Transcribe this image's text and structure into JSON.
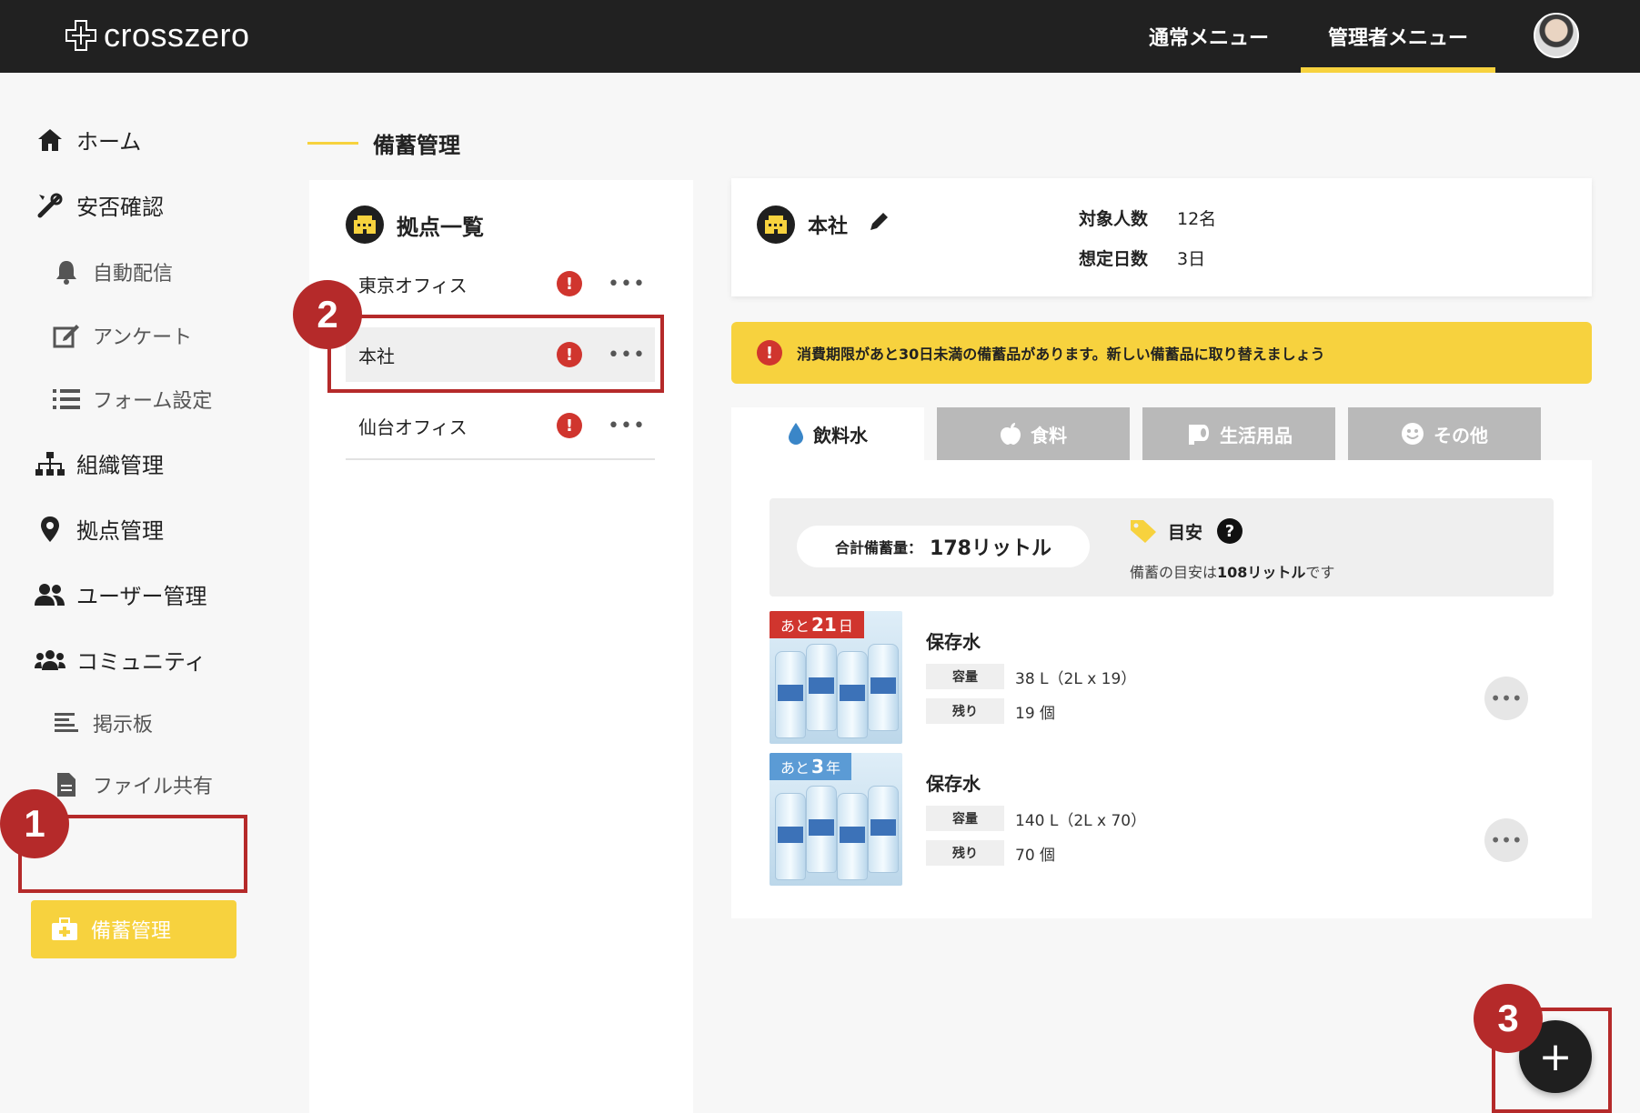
{
  "app": {
    "logo_text": "crosszero"
  },
  "top_nav": [
    {
      "label": "通常メニュー",
      "active": false
    },
    {
      "label": "管理者メニュー",
      "active": true
    }
  ],
  "sidebar": {
    "items": [
      {
        "label": "ホーム",
        "icon": "home-icon"
      },
      {
        "label": "安否確認",
        "icon": "tools-icon"
      },
      {
        "label": "自動配信",
        "icon": "bell-icon"
      },
      {
        "label": "アンケート",
        "icon": "edit-icon"
      },
      {
        "label": "フォーム設定",
        "icon": "list-icon"
      },
      {
        "label": "組織管理",
        "icon": "org-chart-icon"
      },
      {
        "label": "拠点管理",
        "icon": "map-pin-icon"
      },
      {
        "label": "ユーザー管理",
        "icon": "users-icon"
      },
      {
        "label": "コミュニティ",
        "icon": "community-icon"
      },
      {
        "label": "掲示板",
        "icon": "board-icon"
      },
      {
        "label": "ファイル共有",
        "icon": "file-icon"
      },
      {
        "label": "備蓄管理",
        "icon": "first-aid-kit-icon",
        "active": true
      }
    ]
  },
  "page": {
    "title": "備蓄管理"
  },
  "locations": {
    "heading": "拠点一覧",
    "items": [
      {
        "name": "東京オフィス",
        "warning": "!"
      },
      {
        "name": "本社",
        "warning": "!",
        "selected": true
      },
      {
        "name": "仙台オフィス",
        "warning": "!"
      }
    ],
    "more_label": "•••"
  },
  "info": {
    "name": "本社",
    "target_people_label": "対象人数",
    "target_people_value": "12名",
    "days_label": "想定日数",
    "days_value": "3日"
  },
  "alert": {
    "icon_text": "!",
    "text": "消費期限があと30日未満の備蓄品があります。新しい備蓄品に取り替えましょう"
  },
  "tabs": [
    {
      "label": "飲料水",
      "icon": "water-drop-icon",
      "active": true
    },
    {
      "label": "食料",
      "icon": "apple-icon",
      "active": false
    },
    {
      "label": "生活用品",
      "icon": "toilet-paper-icon",
      "active": false
    },
    {
      "label": "その他",
      "icon": "smile-icon",
      "active": false
    }
  ],
  "summary": {
    "total_label": "合計備蓄量：",
    "total_value": "178リットル",
    "meyasu_label": "目安",
    "help_icon_text": "?",
    "meyasu_prefix": "備蓄の目安は",
    "meyasu_amount": "108リットル",
    "meyasu_suffix": "です"
  },
  "items": [
    {
      "ribbon_prefix": "あと",
      "ribbon_number": "21",
      "ribbon_suffix": "日",
      "ribbon_color": "#d0352e",
      "name": "保存水",
      "capacity_label": "容量",
      "capacity_value": "38 L（2L x 19）",
      "remaining_label": "残り",
      "remaining_value": "19 個"
    },
    {
      "ribbon_prefix": "あと",
      "ribbon_number": "3",
      "ribbon_suffix": "年",
      "ribbon_color": "#5b9bd5",
      "name": "保存水",
      "capacity_label": "容量",
      "capacity_value": "140 L（2L x 70）",
      "remaining_label": "残り",
      "remaining_value": "70 個"
    }
  ],
  "fab": {
    "label": "+"
  },
  "callouts": [
    {
      "number": "1"
    },
    {
      "number": "2"
    },
    {
      "number": "3"
    }
  ],
  "colors": {
    "accent": "#f7d23e",
    "dark": "#212121",
    "warning": "#d0352e",
    "callout": "#b52a2a"
  }
}
